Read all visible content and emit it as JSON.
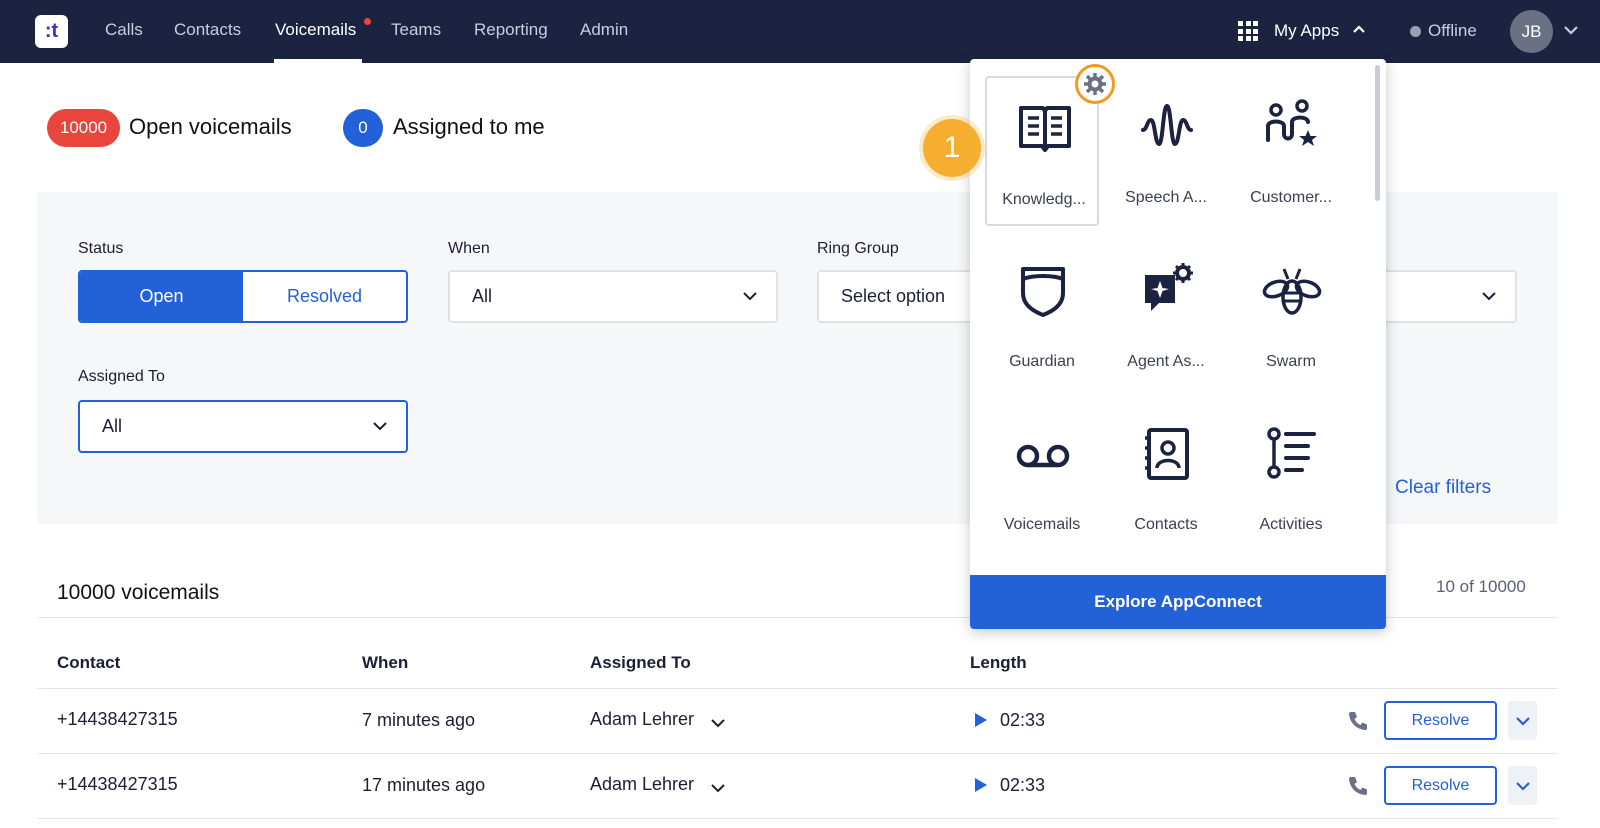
{
  "nav": {
    "logo": ":t",
    "links": [
      "Calls",
      "Contacts",
      "Voicemails",
      "Teams",
      "Reporting",
      "Admin"
    ],
    "active": "Voicemails",
    "my_apps": "My Apps",
    "status": "Offline",
    "avatar_initials": "JB"
  },
  "counters": {
    "open_count": "10000",
    "open_label": "Open voicemails",
    "assigned_count": "0",
    "assigned_label": "Assigned to me"
  },
  "filters": {
    "status_label": "Status",
    "status_options": [
      "Open",
      "Resolved"
    ],
    "status_selected": "Open",
    "when_label": "When",
    "when_value": "All",
    "ring_group_label": "Ring Group",
    "ring_group_value": "Select option",
    "assigned_label": "Assigned To",
    "assigned_value": "All",
    "clear": "Clear filters"
  },
  "table": {
    "title": "10000 voicemails",
    "pager": "10 of 10000",
    "columns": [
      "Contact",
      "When",
      "Assigned To",
      "Length"
    ],
    "rows": [
      {
        "contact": "+14438427315",
        "when": "7 minutes ago",
        "assigned": "Adam Lehrer",
        "length": "02:33",
        "action": "Resolve"
      },
      {
        "contact": "+14438427315",
        "when": "17 minutes ago",
        "assigned": "Adam Lehrer",
        "length": "02:33",
        "action": "Resolve"
      }
    ]
  },
  "apps_menu": {
    "apps": [
      {
        "label": "Knowledg...",
        "icon": "book-icon"
      },
      {
        "label": "Speech A...",
        "icon": "waveform-icon"
      },
      {
        "label": "Customer...",
        "icon": "customer-star-icon"
      },
      {
        "label": "Guardian",
        "icon": "shield-icon"
      },
      {
        "label": "Agent As...",
        "icon": "agent-assist-icon"
      },
      {
        "label": "Swarm",
        "icon": "bee-icon"
      },
      {
        "label": "Voicemails",
        "icon": "voicemail-icon"
      },
      {
        "label": "Contacts",
        "icon": "contacts-book-icon"
      },
      {
        "label": "Activities",
        "icon": "activities-list-icon"
      }
    ],
    "explore": "Explore AppConnect"
  },
  "step_badge": "1",
  "colors": {
    "nav_bg": "#1b2340",
    "accent": "#2361d8",
    "open_pill": "#e8453c",
    "step_badge": "#f5ae2f"
  }
}
